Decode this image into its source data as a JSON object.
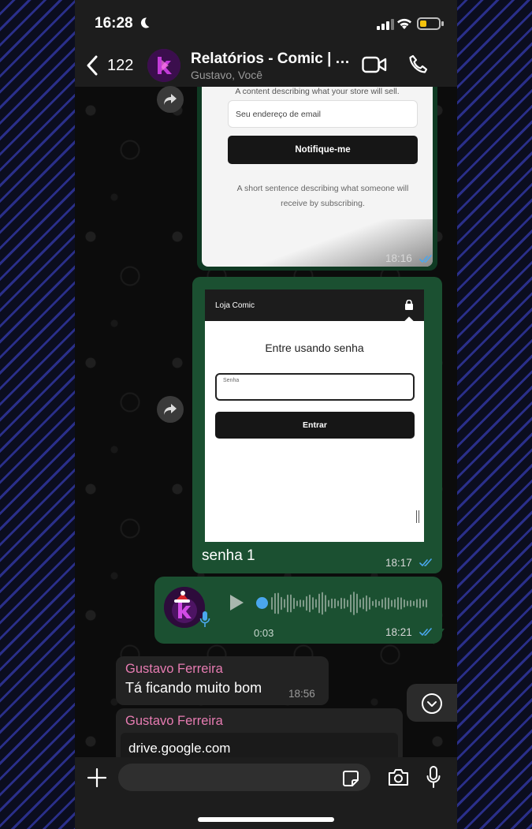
{
  "status_bar": {
    "time": "16:28"
  },
  "header": {
    "back_count": "122",
    "title": "Relatórios - Comic | A...",
    "subtitle": "Gustavo, Você"
  },
  "messages": {
    "image1": {
      "description_text": "A content describing what your store will sell.",
      "email_placeholder": "Seu endereço de email",
      "notify_button": "Notifique-me",
      "note": "A short sentence describing what someone will receive by subscribing.",
      "time": "18:16"
    },
    "image2": {
      "store_name": "Loja Comic",
      "heading": "Entre usando senha",
      "password_label": "Senha",
      "enter_button": "Entrar",
      "caption": "senha 1",
      "time": "18:17"
    },
    "voice": {
      "duration": "0:03",
      "time": "18:21"
    },
    "incoming1": {
      "sender": "Gustavo Ferreira",
      "text": "Tá ficando muito bom",
      "time": "18:56"
    },
    "incoming2": {
      "sender": "Gustavo Ferreira",
      "link": "drive.google.com"
    }
  },
  "colors": {
    "outgoing_bubble": "#1b5031",
    "incoming_bubble": "#232323",
    "sender_name": "#e77cb2",
    "read_ticks": "#4aa7ee"
  },
  "icons": [
    "moon-icon",
    "signal-icon",
    "wifi-icon",
    "battery-icon",
    "back-chevron-icon",
    "video-call-icon",
    "phone-call-icon",
    "forward-icon",
    "lock-icon",
    "play-icon",
    "mic-icon",
    "chevron-down-icon",
    "plus-icon",
    "sticker-icon",
    "camera-icon"
  ]
}
